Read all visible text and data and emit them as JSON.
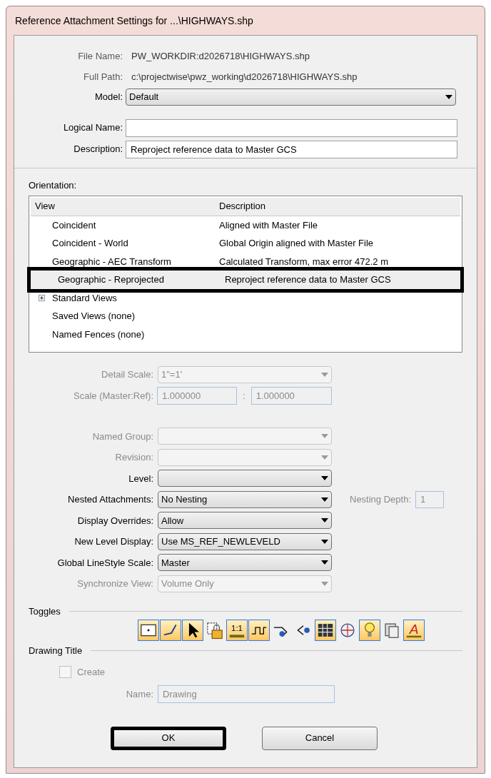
{
  "window": {
    "title": "Reference Attachment Settings for ...\\HIGHWAYS.shp"
  },
  "info": [
    {
      "label": "File Name:",
      "value": "PW_WORKDIR:d2026718\\HIGHWAYS.shp"
    },
    {
      "label": "Full Path:",
      "value": "c:\\projectwise\\pwz_working\\d2026718\\HIGHWAYS.shp"
    }
  ],
  "model": {
    "label": "Model:",
    "value": "Default"
  },
  "fields": [
    {
      "label": "Logical Name:"
    },
    {
      "label": "Description:",
      "value": "Reproject reference data to Master GCS"
    }
  ],
  "orientation": {
    "label": "Orientation:",
    "columns": [
      "View",
      "Description"
    ],
    "rows": [
      {
        "view": "Coincident",
        "description": "Aligned with Master File",
        "selected": false
      },
      {
        "view": "Coincident - World",
        "description": "Global Origin aligned with Master File",
        "selected": false
      },
      {
        "view": "Geographic - AEC Transform",
        "description": "Calculated Transform, max error 472.2 m",
        "selected": false
      },
      {
        "view": "Geographic - Reprojected",
        "description": "Reproject reference data to Master GCS",
        "selected": true
      },
      {
        "view": "Standard Views",
        "selected": false,
        "expandable": true
      },
      {
        "view": "Saved Views (none)",
        "selected": false
      },
      {
        "view": "Named Fences (none)",
        "selected": false
      }
    ]
  },
  "scale": {
    "detail_label": "Detail Scale:",
    "detail_value": "1\"=1'",
    "ratio_label": "Scale (Master:Ref):",
    "master": "1.000000",
    "separator": ":",
    "ref": "1.000000",
    "disabled": true
  },
  "settings": [
    {
      "label": "Named Group:",
      "disabled": true
    },
    {
      "label": "Revision:",
      "disabled": true
    },
    {
      "label": "Level:",
      "disabled": false
    },
    {
      "label": "Nested Attachments:",
      "value": "No Nesting",
      "disabled": false,
      "extra_label": "Nesting Depth:",
      "extra_value": "1"
    },
    {
      "label": "Display Overrides:",
      "value": "Allow",
      "disabled": false
    },
    {
      "label": "New Level Display:",
      "value": "Use MS_REF_NEWLEVELD",
      "disabled": false
    },
    {
      "label": "Global LineStyle Scale:",
      "value": "Master",
      "disabled": false
    },
    {
      "label": "Synchronize View:",
      "value": "Volume Only",
      "disabled": true
    }
  ],
  "toggles": {
    "title": "Toggles",
    "items": [
      {
        "kind": "window",
        "on": true
      },
      {
        "kind": "line",
        "on": true
      },
      {
        "kind": "pointer",
        "on": true
      },
      {
        "kind": "lock",
        "on": false
      },
      {
        "kind": "scale",
        "label": "1:1",
        "on": true
      },
      {
        "kind": "wave",
        "on": true
      },
      {
        "kind": "arrow-in",
        "on": false
      },
      {
        "kind": "arrow-out",
        "on": false
      },
      {
        "kind": "grid",
        "on": true
      },
      {
        "kind": "globe",
        "on": false
      },
      {
        "kind": "bulb",
        "on": true
      },
      {
        "kind": "copy",
        "on": false
      },
      {
        "kind": "text",
        "label": "A",
        "on": true
      }
    ]
  },
  "drawing_title": {
    "title": "Drawing Title",
    "create_label": "Create",
    "checked": false,
    "disabled": true,
    "name_label": "Name:",
    "name_value": "Drawing"
  },
  "buttons": [
    {
      "label": "OK",
      "highlighted": true
    },
    {
      "label": "Cancel",
      "highlighted": false
    }
  ]
}
